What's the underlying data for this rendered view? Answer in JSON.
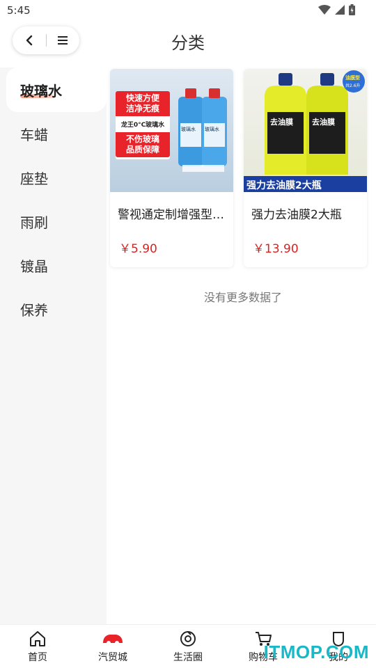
{
  "status_bar": {
    "time": "5:45"
  },
  "header": {
    "title": "分类"
  },
  "sidebar": {
    "items": [
      {
        "label": "玻璃水",
        "active": true
      },
      {
        "label": "车蜡"
      },
      {
        "label": "座垫"
      },
      {
        "label": "雨刷"
      },
      {
        "label": "镀晶"
      },
      {
        "label": "保养"
      }
    ]
  },
  "products": [
    {
      "title": "警视通定制增强型玻璃水",
      "price": "￥5.90",
      "image_text": [
        "快速方便",
        "洁净无痕",
        "龙王0°C玻璃水",
        "不伤玻璃",
        "品质保障",
        "玻璃水",
        "玻璃水"
      ]
    },
    {
      "title": "强力去油膜2大瓶",
      "price": "￥13.90",
      "image_text": [
        "去油膜",
        "去油膜",
        "强力去油膜2大瓶",
        "油膜型",
        "共2.6升"
      ]
    }
  ],
  "list_end": "没有更多数据了",
  "tabbar": {
    "items": [
      {
        "label": "首页",
        "icon": "home-icon"
      },
      {
        "label": "汽贸城",
        "icon": "car-icon"
      },
      {
        "label": "生活圈",
        "icon": "circle-icon"
      },
      {
        "label": "购物车",
        "icon": "cart-icon"
      },
      {
        "label": "我的",
        "icon": "user-icon"
      }
    ]
  },
  "watermark": "ITMOP.COM",
  "colors": {
    "price": "#e02020",
    "accent": "#e8232a",
    "watermark": "#19b8c8"
  }
}
